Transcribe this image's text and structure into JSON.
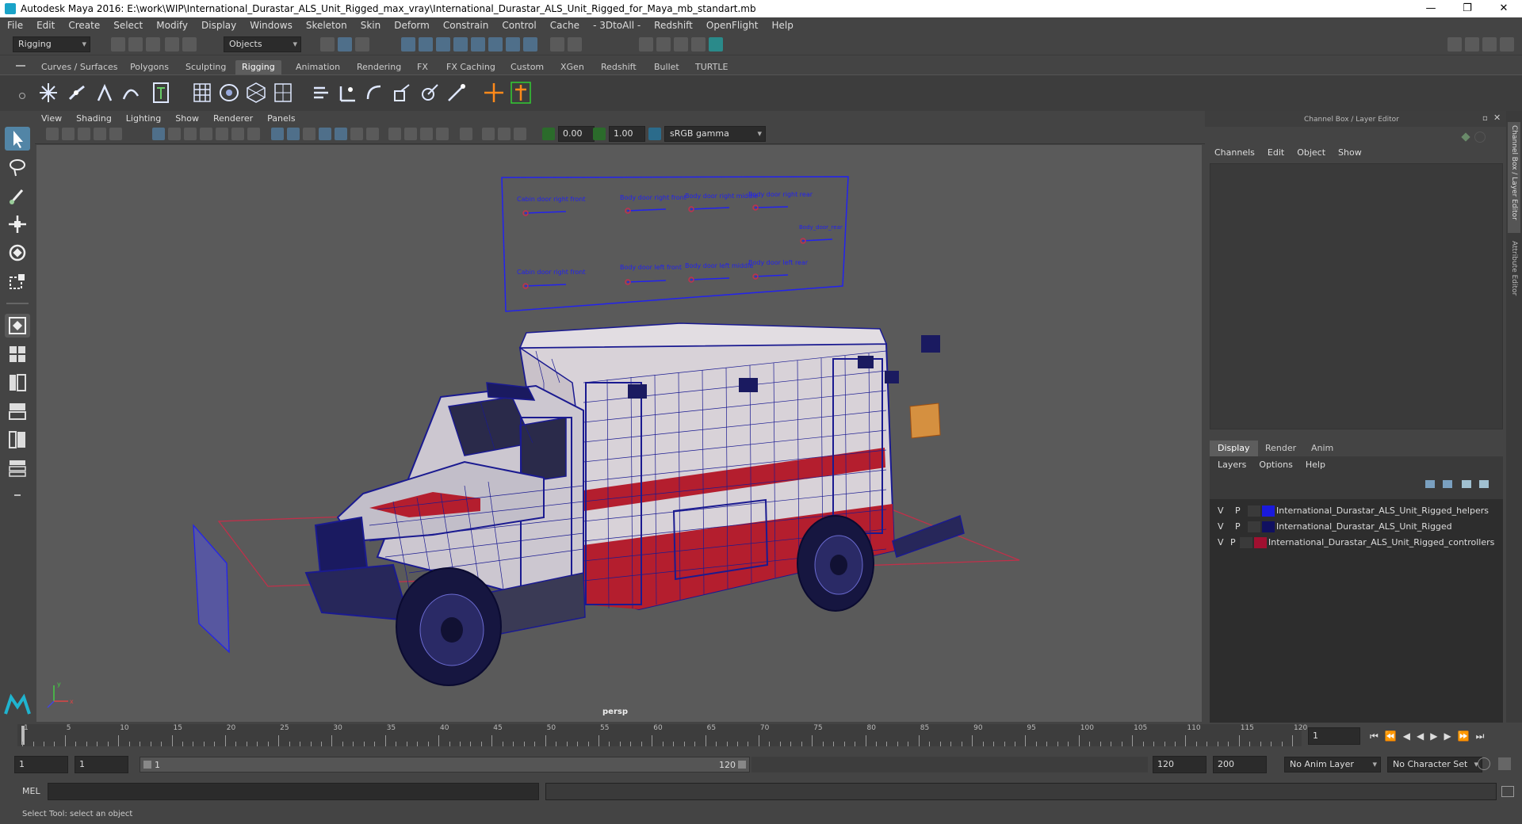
{
  "title": "Autodesk Maya 2016: E:\\work\\WIP\\International_Durastar_ALS_Unit_Rigged_max_vray\\International_Durastar_ALS_Unit_Rigged_for_Maya_mb_standart.mb",
  "window_buttons": {
    "minimize": "—",
    "maximize": "❐",
    "close": "✕"
  },
  "menu": [
    "File",
    "Edit",
    "Create",
    "Select",
    "Modify",
    "Display",
    "Windows",
    "Skeleton",
    "Skin",
    "Deform",
    "Constrain",
    "Control",
    "Cache",
    "- 3DtoAll -",
    "Redshift",
    "OpenFlight",
    "Help"
  ],
  "status": {
    "menuset": "Rigging",
    "select_mode": "Objects"
  },
  "shelf_tabs": [
    "Curves / Surfaces",
    "Polygons",
    "Sculpting",
    "Rigging",
    "Animation",
    "Rendering",
    "FX",
    "FX Caching",
    "Custom",
    "XGen",
    "Redshift",
    "Bullet",
    "TURTLE"
  ],
  "active_shelf_tab": "Rigging",
  "viewport": {
    "menu": [
      "View",
      "Shading",
      "Lighting",
      "Show",
      "Renderer",
      "Panels"
    ],
    "exposure": "0.00",
    "gamma": "1.00",
    "colorspace": "sRGB gamma",
    "camera_label": "persp",
    "axis_y": "y",
    "axis_x": "x"
  },
  "rig_labels": {
    "cabin_front_top": "Cabin door right front",
    "body_right_front": "Body door right front",
    "body_right_middle": "Body door right middle",
    "body_right_rear": "Body door right rear",
    "body_rear": "Body_door_rear",
    "cabin_front_bottom": "Cabin door right front",
    "body_left_front": "Body door left front",
    "body_left_middle": "Body door left middle",
    "body_left_rear": "Body door left rear"
  },
  "channel_box": {
    "header": "Channel Box / Layer Editor",
    "menu": [
      "Channels",
      "Edit",
      "Object",
      "Show"
    ],
    "layer_tabs": [
      "Display",
      "Render",
      "Anim"
    ],
    "active_layer_tab": "Display",
    "layer_menu": [
      "Layers",
      "Options",
      "Help"
    ],
    "layers": [
      {
        "v": "V",
        "p": "P",
        "color": "#1a1adc",
        "name": "International_Durastar_ALS_Unit_Rigged_helpers"
      },
      {
        "v": "V",
        "p": "P",
        "color": "#101060",
        "name": "International_Durastar_ALS_Unit_Rigged"
      },
      {
        "v": "V",
        "p": "P",
        "color": "#a01030",
        "name": "International_Durastar_ALS_Unit_Rigged_controllers"
      }
    ]
  },
  "side_tabs": {
    "channel_box": "Channel Box / Layer Editor",
    "attribute_editor": "Attribute Editor"
  },
  "timeline": {
    "ticks": [
      "1",
      "5",
      "10",
      "15",
      "20",
      "25",
      "30",
      "35",
      "40",
      "45",
      "50",
      "55",
      "60",
      "65",
      "70",
      "75",
      "80",
      "85",
      "90",
      "95",
      "100",
      "105",
      "110",
      "115",
      "120"
    ],
    "current_frame": "1"
  },
  "range": {
    "start": "1",
    "playback_start": "1",
    "slider_start": "1",
    "slider_end": "120",
    "playback_end": "120",
    "end": "200",
    "anim_layer": "No Anim Layer",
    "character_set": "No Character Set"
  },
  "mel": {
    "label": "MEL"
  },
  "help_text": "Select Tool: select an object"
}
